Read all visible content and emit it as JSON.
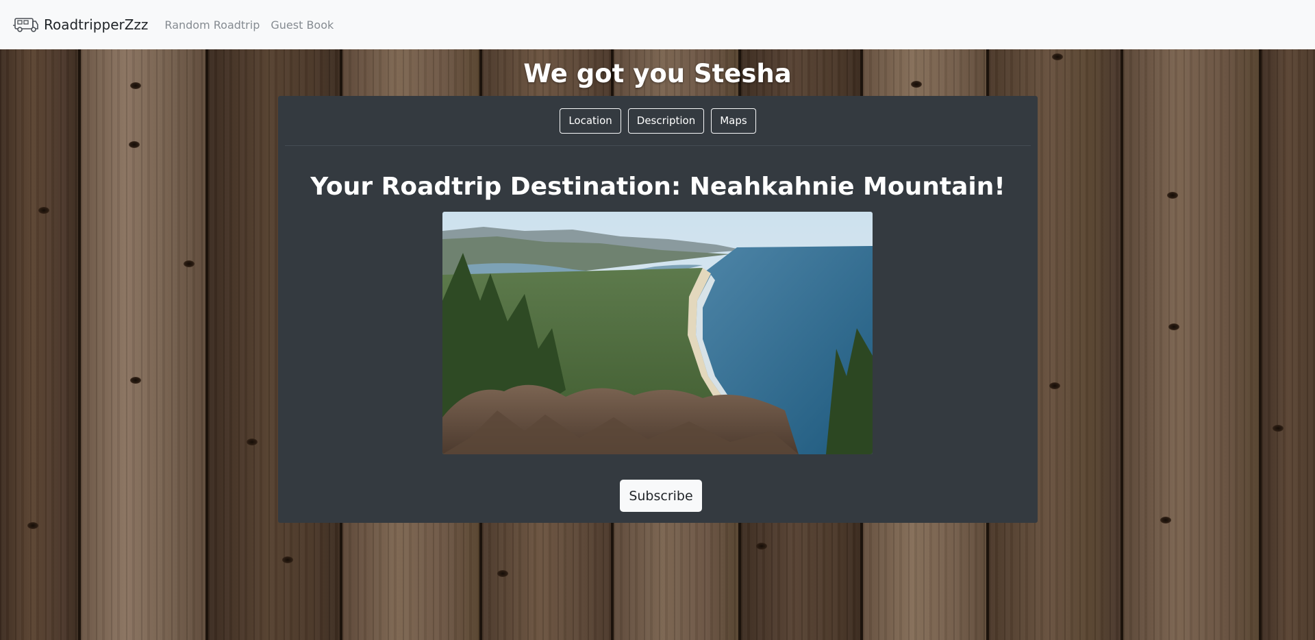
{
  "nav": {
    "brand": "RoadtripperZzz",
    "brand_icon": "camper-van-icon",
    "links": [
      {
        "label": "Random Roadtrip"
      },
      {
        "label": "Guest Book"
      }
    ]
  },
  "page": {
    "heading": "We got you Stesha"
  },
  "card": {
    "tabs": [
      {
        "label": "Location"
      },
      {
        "label": "Description"
      },
      {
        "label": "Maps"
      }
    ],
    "destination_title": "Your Roadtrip Destination: Neahkahnie Mountain!",
    "photo": "coastal-mountain-view-photo",
    "subscribe_label": "Subscribe"
  },
  "colors": {
    "navbar_bg": "#f8f9fa",
    "card_bg": "#343a40",
    "wood": "#4a3627",
    "text_light": "#ffffff",
    "nav_link": "#858b91"
  }
}
